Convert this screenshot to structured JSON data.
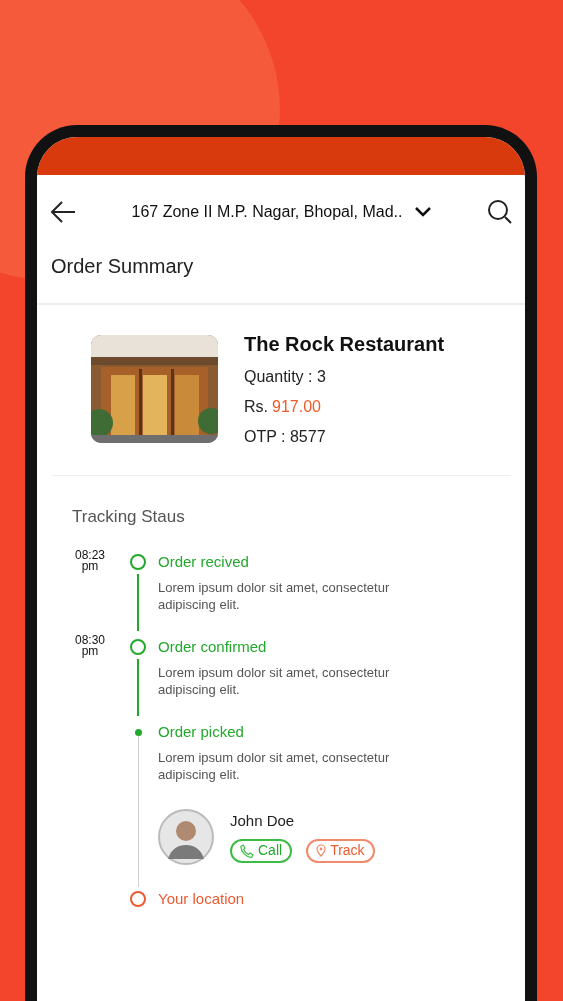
{
  "header": {
    "address": "167 Zone II M.P. Nagar, Bhopal, Mad.."
  },
  "title": "Order Summary",
  "order": {
    "restaurant": "The Rock Restaurant",
    "quantity": "Quantity : 3",
    "price_label": "Rs.",
    "price": "917.00",
    "otp": "OTP : 8577"
  },
  "tracking": {
    "title": "Tracking Staus",
    "steps": [
      {
        "kind": "done",
        "time": "08:23",
        "period": "pm",
        "title": "Order recived",
        "description": "Lorem ipsum dolor sit amet, consectetur adipiscing elit."
      },
      {
        "kind": "done",
        "time": "08:30",
        "period": "pm",
        "title": "Order confirmed",
        "description": "Lorem ipsum dolor sit amet, consectetur adipiscing elit."
      },
      {
        "kind": "current",
        "title": "Order picked",
        "description": "Lorem ipsum dolor sit amet, consectetur adipiscing elit.",
        "courier": {
          "name": "John Doe",
          "actions": [
            {
              "kind": "call",
              "label": "Call"
            },
            {
              "kind": "track",
              "label": "Track"
            }
          ]
        }
      },
      {
        "kind": "pending",
        "title": "Your location"
      }
    ]
  }
}
